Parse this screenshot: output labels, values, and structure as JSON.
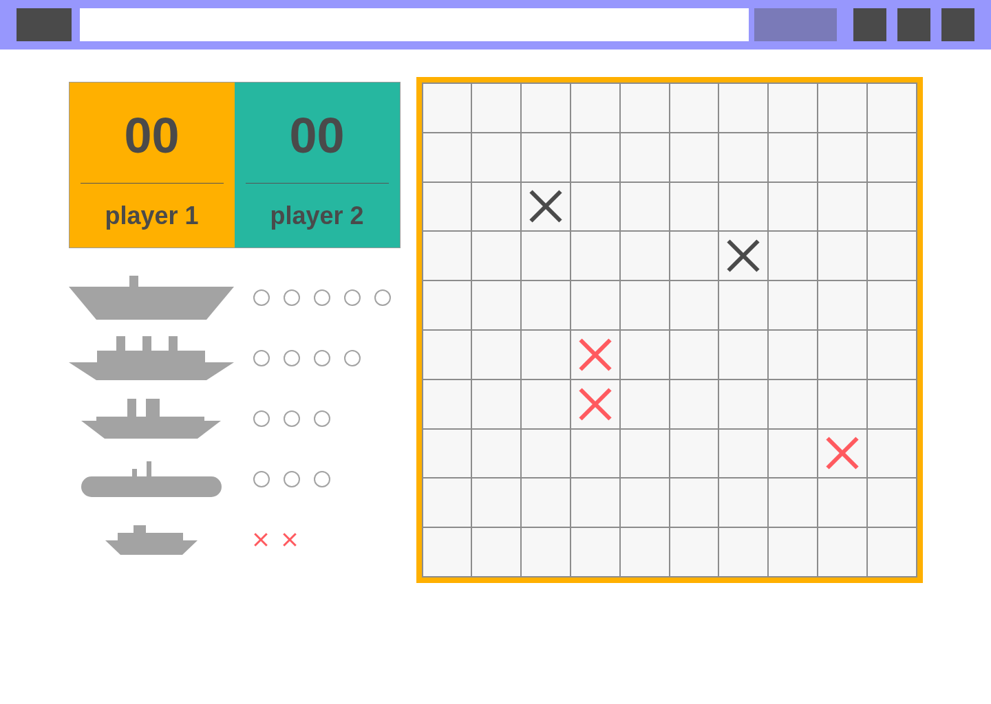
{
  "players": [
    {
      "score": "00",
      "name": "player 1",
      "color": "#ffb000"
    },
    {
      "score": "00",
      "name": "player 2",
      "color": "#26b7a0"
    }
  ],
  "fleet": [
    {
      "kind": "carrier",
      "pegs": [
        {
          "hit": false
        },
        {
          "hit": false
        },
        {
          "hit": false
        },
        {
          "hit": false
        },
        {
          "hit": false
        }
      ]
    },
    {
      "kind": "battleship",
      "pegs": [
        {
          "hit": false
        },
        {
          "hit": false
        },
        {
          "hit": false
        },
        {
          "hit": false
        }
      ]
    },
    {
      "kind": "cruiser",
      "pegs": [
        {
          "hit": false
        },
        {
          "hit": false
        },
        {
          "hit": false
        }
      ]
    },
    {
      "kind": "submarine",
      "pegs": [
        {
          "hit": false
        },
        {
          "hit": false
        },
        {
          "hit": false
        }
      ]
    },
    {
      "kind": "destroyer",
      "pegs": [
        {
          "hit": true
        },
        {
          "hit": true
        }
      ]
    }
  ],
  "board": {
    "rows": [
      {
        "cells": [
          {
            "kind": "empty"
          },
          {
            "kind": "empty"
          },
          {
            "kind": "empty"
          },
          {
            "kind": "empty"
          },
          {
            "kind": "empty"
          },
          {
            "kind": "empty"
          },
          {
            "kind": "empty"
          },
          {
            "kind": "empty"
          },
          {
            "kind": "empty"
          },
          {
            "kind": "empty"
          }
        ]
      },
      {
        "cells": [
          {
            "kind": "empty"
          },
          {
            "kind": "empty"
          },
          {
            "kind": "empty"
          },
          {
            "kind": "empty"
          },
          {
            "kind": "empty"
          },
          {
            "kind": "empty"
          },
          {
            "kind": "empty"
          },
          {
            "kind": "empty"
          },
          {
            "kind": "empty"
          },
          {
            "kind": "empty"
          }
        ]
      },
      {
        "cells": [
          {
            "kind": "empty"
          },
          {
            "kind": "empty"
          },
          {
            "kind": "miss"
          },
          {
            "kind": "empty"
          },
          {
            "kind": "empty"
          },
          {
            "kind": "empty"
          },
          {
            "kind": "empty"
          },
          {
            "kind": "empty"
          },
          {
            "kind": "empty"
          },
          {
            "kind": "empty"
          }
        ]
      },
      {
        "cells": [
          {
            "kind": "empty"
          },
          {
            "kind": "empty"
          },
          {
            "kind": "empty"
          },
          {
            "kind": "empty"
          },
          {
            "kind": "empty"
          },
          {
            "kind": "empty"
          },
          {
            "kind": "miss"
          },
          {
            "kind": "empty"
          },
          {
            "kind": "empty"
          },
          {
            "kind": "empty"
          }
        ]
      },
      {
        "cells": [
          {
            "kind": "empty"
          },
          {
            "kind": "empty"
          },
          {
            "kind": "empty"
          },
          {
            "kind": "empty"
          },
          {
            "kind": "empty"
          },
          {
            "kind": "empty"
          },
          {
            "kind": "empty"
          },
          {
            "kind": "empty"
          },
          {
            "kind": "empty"
          },
          {
            "kind": "empty"
          }
        ]
      },
      {
        "cells": [
          {
            "kind": "empty"
          },
          {
            "kind": "empty"
          },
          {
            "kind": "empty"
          },
          {
            "kind": "hit"
          },
          {
            "kind": "empty"
          },
          {
            "kind": "empty"
          },
          {
            "kind": "empty"
          },
          {
            "kind": "empty"
          },
          {
            "kind": "empty"
          },
          {
            "kind": "empty"
          }
        ]
      },
      {
        "cells": [
          {
            "kind": "empty"
          },
          {
            "kind": "empty"
          },
          {
            "kind": "empty"
          },
          {
            "kind": "hit"
          },
          {
            "kind": "empty"
          },
          {
            "kind": "empty"
          },
          {
            "kind": "empty"
          },
          {
            "kind": "empty"
          },
          {
            "kind": "empty"
          },
          {
            "kind": "empty"
          }
        ]
      },
      {
        "cells": [
          {
            "kind": "empty"
          },
          {
            "kind": "empty"
          },
          {
            "kind": "empty"
          },
          {
            "kind": "empty"
          },
          {
            "kind": "empty"
          },
          {
            "kind": "empty"
          },
          {
            "kind": "empty"
          },
          {
            "kind": "empty"
          },
          {
            "kind": "hit"
          },
          {
            "kind": "empty"
          }
        ]
      },
      {
        "cells": [
          {
            "kind": "empty"
          },
          {
            "kind": "empty"
          },
          {
            "kind": "empty"
          },
          {
            "kind": "empty"
          },
          {
            "kind": "empty"
          },
          {
            "kind": "empty"
          },
          {
            "kind": "empty"
          },
          {
            "kind": "empty"
          },
          {
            "kind": "empty"
          },
          {
            "kind": "empty"
          }
        ]
      },
      {
        "cells": [
          {
            "kind": "empty"
          },
          {
            "kind": "empty"
          },
          {
            "kind": "empty"
          },
          {
            "kind": "empty"
          },
          {
            "kind": "empty"
          },
          {
            "kind": "empty"
          },
          {
            "kind": "empty"
          },
          {
            "kind": "empty"
          },
          {
            "kind": "empty"
          },
          {
            "kind": "empty"
          }
        ]
      }
    ]
  }
}
